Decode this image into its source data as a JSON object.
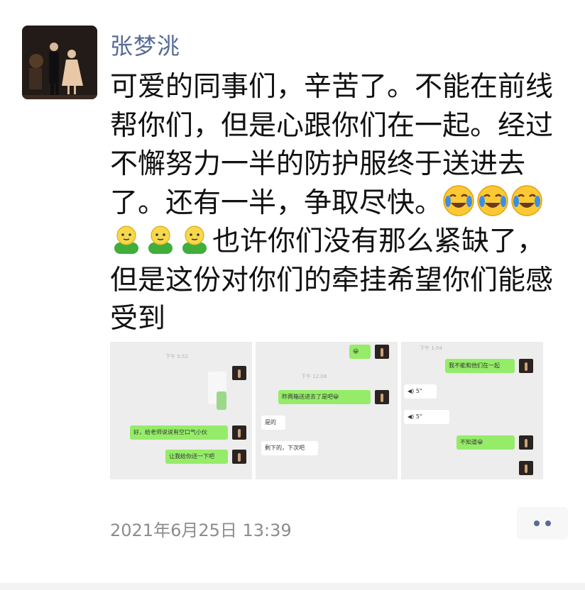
{
  "post": {
    "author": "张梦洮",
    "text_part1": "可爱的同事们，辛苦了。不能在前线帮你们，但是心跟你们在一起。经过不懈努力一半的防护服终于送进去了。还有一半，争取尽快。",
    "text_part2": "也许你们没有那么紧缺了，但是这份对你们的牵挂希望你们能感受到",
    "emojis_row1": [
      "crying-laughing-emoji",
      "crying-laughing-emoji",
      "crying-laughing-emoji"
    ],
    "emojis_row2": [
      "green-person-emoji",
      "green-person-emoji",
      "green-person-emoji"
    ],
    "timestamp": "2021年6月25日 13:39"
  },
  "images": [
    {
      "time": "下午 5:52",
      "bubbles": [
        {
          "type": "green",
          "text": "好，给老师说说有空口气小伙"
        },
        {
          "type": "green",
          "text": "让我给你送一下吧"
        }
      ]
    },
    {
      "time": "下午 12:08",
      "bubbles": [
        {
          "type": "green",
          "text": "😀"
        },
        {
          "type": "green",
          "text": "昨两箱送进去了是吧😀"
        },
        {
          "type": "white",
          "text": "是的"
        },
        {
          "type": "white",
          "text": "剩下的，下次吧"
        }
      ]
    },
    {
      "time": "下午 1:04",
      "bubbles": [
        {
          "type": "green",
          "text": "我不能和他们在一起"
        },
        {
          "type": "white",
          "text": "◀) 5\""
        },
        {
          "type": "white",
          "text": "◀) 5\""
        },
        {
          "type": "green",
          "text": "不知道😀"
        }
      ]
    }
  ],
  "actions": {
    "more_icon": "more-dots-icon"
  },
  "colors": {
    "author": "#576b95",
    "bubble_green": "#95ec69",
    "timestamp": "#8c8c8c"
  }
}
